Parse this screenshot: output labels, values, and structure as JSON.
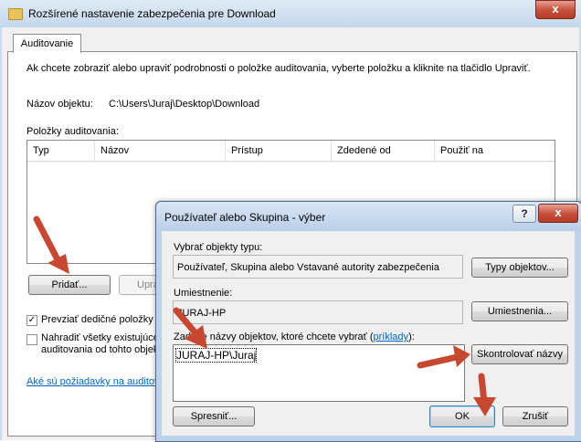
{
  "main_window": {
    "title": "Rozšírené nastavenie zabezpečenia pre Download",
    "close_glyph": "x",
    "tab_label": "Auditovanie",
    "instruction": "Ak chcete zobraziť alebo upraviť podrobnosti o položke auditovania, vyberte položku a kliknite na tlačidlo Upraviť.",
    "object_name_label": "Názov objektu:",
    "object_name_value": "C:\\Users\\Juraj\\Desktop\\Download",
    "entries_label": "Položky auditovania:",
    "columns": [
      "Typ",
      "Názov",
      "Prístup",
      "Zdedené od",
      "Použiť na"
    ],
    "add_button": "Pridať...",
    "edit_button_partial": "Upra",
    "inherit_checkbox": {
      "label": "Prevziať dedičné položky a",
      "checked": true
    },
    "replace_checkbox": {
      "label_line1": "Nahradiť všetky existujúce",
      "label_line2": "auditovania od tohto objek",
      "checked": false
    },
    "requirements_link": "Aké sú požiadavky na auditov"
  },
  "dialog": {
    "title": "Používateľ alebo Skupina - výber",
    "help_glyph": "?",
    "close_glyph": "x",
    "object_types_label": "Vybrať objekty typu:",
    "object_types_value": "Používateľ, Skupina alebo Vstavané autority zabezpečenia",
    "object_types_button": "Typy objektov...",
    "location_label": "Umiestnenie:",
    "location_value": "JURAJ-HP",
    "location_button": "Umiestnenia...",
    "names_label_prefix": "Zadajte názvy objektov, ktoré chcete vybrať (",
    "names_label_link": "príklady",
    "names_label_suffix": "):",
    "names_value": "JURAJ-HP\\Juraj",
    "check_names_button": "Skontrolovať názvy",
    "advanced_button": "Spresniť...",
    "ok_button": "OK",
    "cancel_button": "Zrušiť"
  },
  "colors": {
    "arrow": "#c8482f",
    "link": "#0066cc"
  }
}
